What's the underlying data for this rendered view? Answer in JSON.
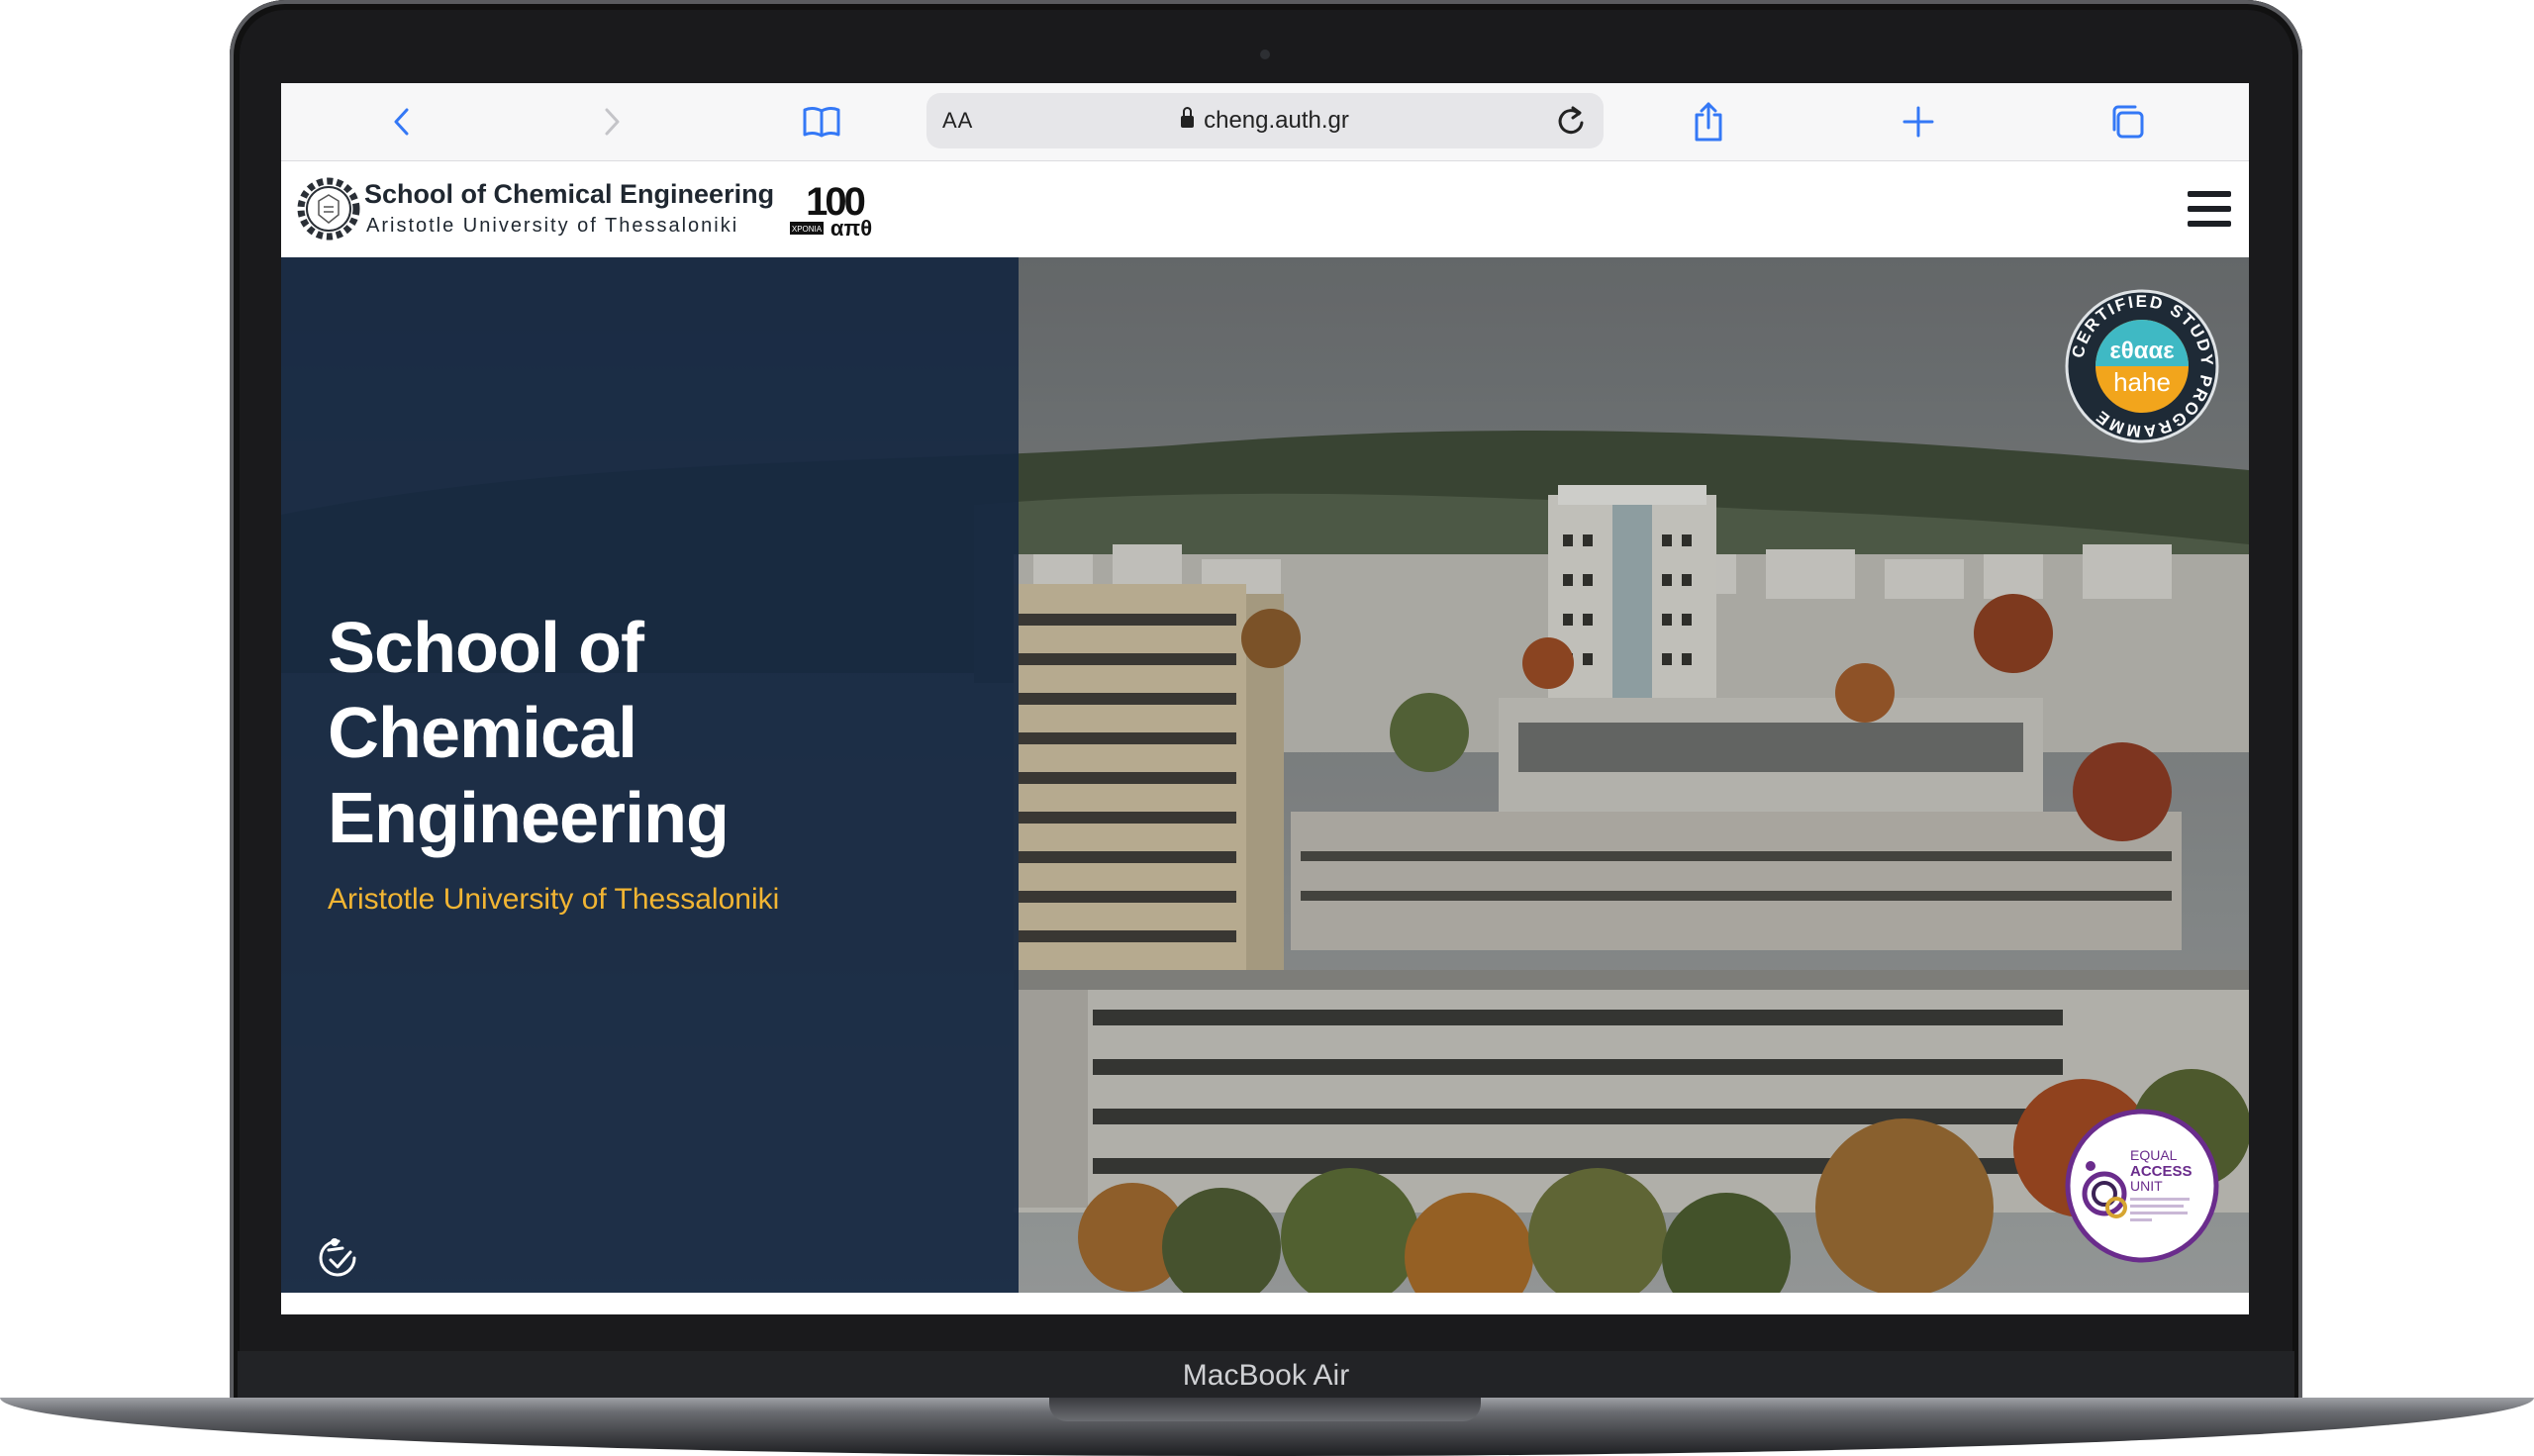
{
  "device": {
    "label": "MacBook Air"
  },
  "browser": {
    "text_size_label": "AA",
    "url": "cheng.auth.gr",
    "icons": [
      "back-icon",
      "forward-icon",
      "bookmarks-icon",
      "lock-icon",
      "reload-icon",
      "share-icon",
      "new-tab-icon",
      "tabs-icon"
    ]
  },
  "site": {
    "brand_title": "School of Chemical Engineering",
    "brand_subtitle": "Aristotle University of Thessaloniki",
    "anniversary_number": "100",
    "anniversary_caption": "ΧΡΟΝΙΑ",
    "anniversary_word": "απθ",
    "menu_icon": "hamburger-icon"
  },
  "hero": {
    "title_lines": [
      "School of",
      "Chemical",
      "Engineering"
    ],
    "subtitle": "Aristotle University of Thessaloniki",
    "accessibility_icon": "accessibility-icon"
  },
  "badges": {
    "certified": {
      "ring_text": "CERTIFIED STUDY PROGRAMME",
      "greek": "εθααε",
      "english": "hahe"
    },
    "equal_access": {
      "line1": "EQUAL",
      "line2": "ACCESS",
      "line3": "UNIT"
    }
  },
  "colors": {
    "panel": "#162842",
    "accent_yellow": "#f2b533",
    "safari_blue": "#3478f6",
    "badge_teal": "#3fb9c4",
    "badge_orange": "#f2a51c",
    "equal_access_purple": "#6a2c8c"
  }
}
